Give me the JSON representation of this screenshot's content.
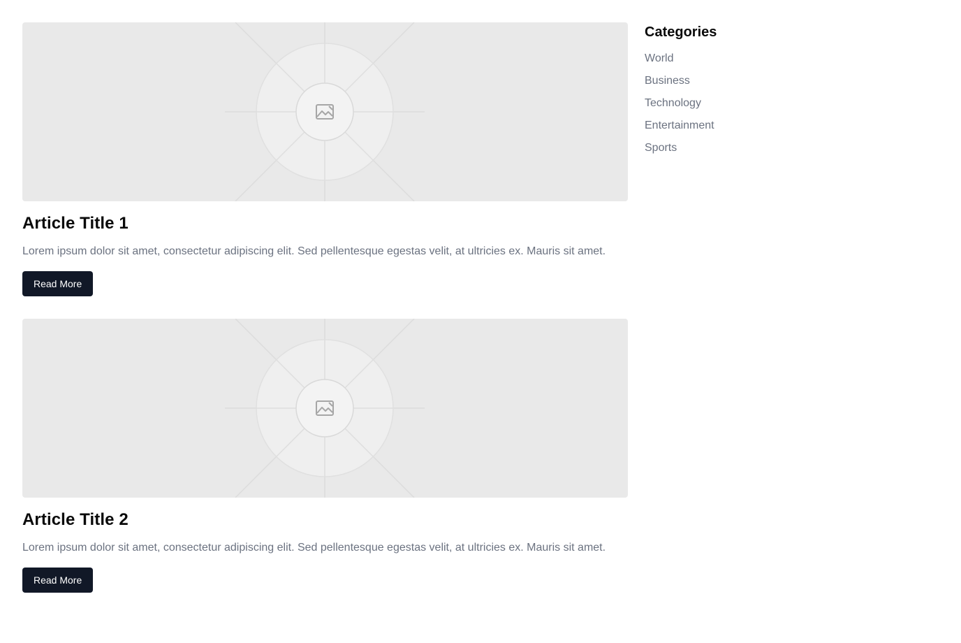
{
  "articles": [
    {
      "title": "Article Title 1",
      "excerpt": "Lorem ipsum dolor sit amet, consectetur adipiscing elit. Sed pellentesque egestas velit, at ultricies ex. Mauris sit amet.",
      "button_label": "Read More",
      "image_icon": "image-placeholder-icon"
    },
    {
      "title": "Article Title 2",
      "excerpt": "Lorem ipsum dolor sit amet, consectetur adipiscing elit. Sed pellentesque egestas velit, at ultricies ex. Mauris sit amet.",
      "button_label": "Read More",
      "image_icon": "image-placeholder-icon"
    }
  ],
  "sidebar": {
    "title": "Categories",
    "items": [
      {
        "label": "World"
      },
      {
        "label": "Business"
      },
      {
        "label": "Technology"
      },
      {
        "label": "Entertainment"
      },
      {
        "label": "Sports"
      }
    ]
  },
  "colors": {
    "button_bg": "#111827",
    "placeholder_bg": "#e9e9e9",
    "muted_text": "#6b7280"
  }
}
